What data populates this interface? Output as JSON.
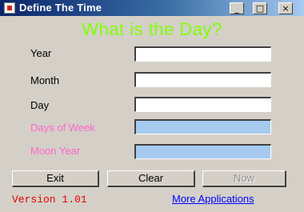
{
  "window": {
    "title": "Define The Time",
    "controls": {
      "minimize": "_",
      "maximize": "□",
      "close": "×"
    }
  },
  "heading": "What is the Day?",
  "form": {
    "year": {
      "label": "Year",
      "value": ""
    },
    "month": {
      "label": "Month",
      "value": ""
    },
    "day": {
      "label": "Day",
      "value": ""
    },
    "days_of_week": {
      "label": "Days of Week",
      "value": ""
    },
    "moon_year": {
      "label": "Moon Year",
      "value": ""
    }
  },
  "buttons": {
    "exit": "Exit",
    "clear": "Clear",
    "now": "Now"
  },
  "footer": {
    "version": "Version 1.01",
    "more_link": "More Applications"
  },
  "colors": {
    "heading": "#80ff00",
    "readonly_field": "#a6caf0",
    "pink_label": "#ff66cc",
    "version": "#e00000",
    "link": "#0000ff"
  }
}
